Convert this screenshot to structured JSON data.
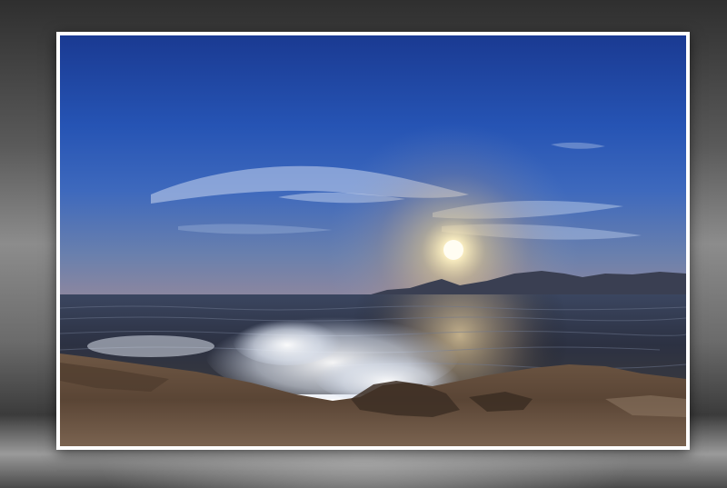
{
  "scene": {
    "subject": "sunset-seascape",
    "colors": {
      "sky_top": "#1d3f99",
      "sky_mid": "#2f5fbf",
      "sky_horizon": "#5f7fb6",
      "sun": "#fff6d6",
      "sea": "#2a2d38",
      "rocks": "#6b5240",
      "frame_border": "#ffffff",
      "backdrop": "#7a7a7a"
    }
  }
}
